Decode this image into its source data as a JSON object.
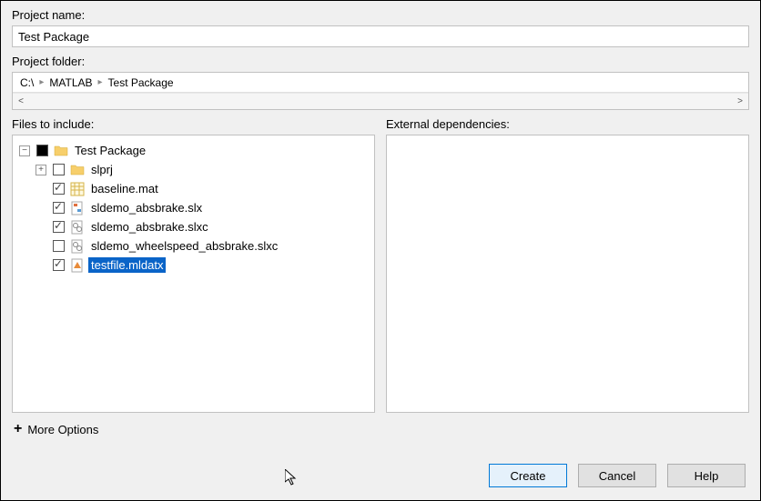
{
  "labels": {
    "project_name": "Project name:",
    "project_folder": "Project folder:",
    "files_to_include": "Files to include:",
    "external_dependencies": "External dependencies:",
    "more_options": "More Options"
  },
  "project_name_value": "Test Package",
  "breadcrumb": {
    "root": "C:\\",
    "seg1": "MATLAB",
    "seg2": "Test Package"
  },
  "tree": {
    "root": "Test Package",
    "items": [
      {
        "name": "slprj"
      },
      {
        "name": "baseline.mat"
      },
      {
        "name": "sldemo_absbrake.slx"
      },
      {
        "name": "sldemo_absbrake.slxc"
      },
      {
        "name": "sldemo_wheelspeed_absbrake.slxc"
      },
      {
        "name": "testfile.mldatx"
      }
    ]
  },
  "buttons": {
    "create": "Create",
    "cancel": "Cancel",
    "help": "Help"
  }
}
